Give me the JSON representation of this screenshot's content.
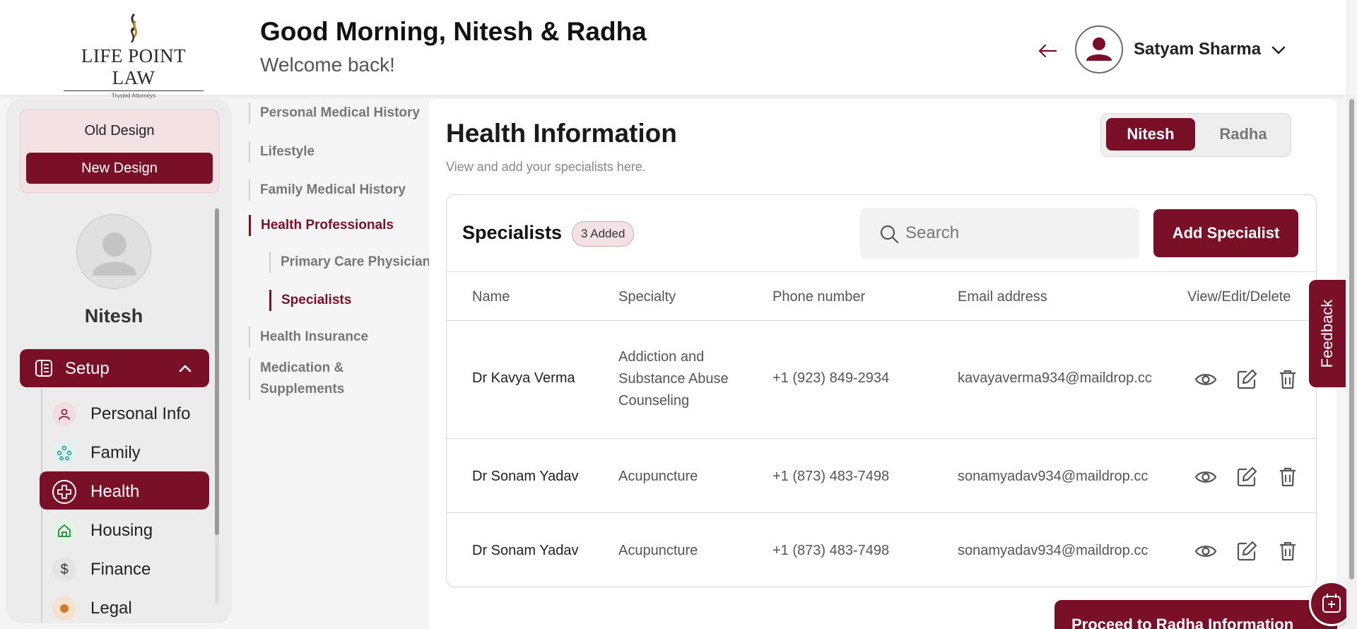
{
  "brand": {
    "name": "LIFE POINT LAW",
    "tagline": "Trusted Attorneys"
  },
  "header": {
    "greeting": "Good Morning, Nitesh & Radha",
    "subtitle": "Welcome back!",
    "user_name": "Satyam Sharma"
  },
  "sidebar": {
    "old_design_label": "Old Design",
    "new_design_label": "New Design",
    "profile_name": "Nitesh",
    "setup_label": "Setup",
    "items": [
      {
        "label": "Personal Info",
        "icon": "person-icon",
        "active": false
      },
      {
        "label": "Family",
        "icon": "family-icon",
        "active": false
      },
      {
        "label": "Health",
        "icon": "health-cross-icon",
        "active": true
      },
      {
        "label": "Housing",
        "icon": "house-icon",
        "active": false
      },
      {
        "label": "Finance",
        "icon": "dollar-icon",
        "active": false
      },
      {
        "label": "Legal",
        "icon": "legal-icon",
        "active": false
      }
    ]
  },
  "subnav": {
    "items": [
      {
        "label": "Personal Medical History",
        "active": false
      },
      {
        "label": "Lifestyle",
        "active": false
      },
      {
        "label": "Family Medical History",
        "active": false
      },
      {
        "label": "Health Professionals",
        "active": true
      },
      {
        "label": "Primary Care Physician",
        "active": false
      },
      {
        "label": "Specialists",
        "active": true
      },
      {
        "label": "Health Insurance",
        "active": false
      },
      {
        "label": "Medication &",
        "active": false
      },
      {
        "label": "Supplements",
        "active": false
      }
    ]
  },
  "main": {
    "title": "Health Information",
    "subtitle": "View and add your specialists here.",
    "toggle": {
      "selected": "Nitesh",
      "other": "Radha"
    },
    "section_title": "Specialists",
    "added_badge": "3 Added",
    "search_placeholder": "Search",
    "add_button": "Add Specialist",
    "columns": [
      "Name",
      "Specialty",
      "Phone number",
      "Email address",
      "View/Edit/Delete"
    ],
    "rows": [
      {
        "name": "Dr Kavya Verma",
        "specialty_lines": [
          "Addiction and",
          "Substance Abuse",
          "Counseling"
        ],
        "phone": "+1 (923) 849-2934",
        "email": "kavayaverma934@maildrop.cc"
      },
      {
        "name": "Dr Sonam Yadav",
        "specialty_lines": [
          "Acupuncture"
        ],
        "phone": "+1 (873) 483-7498",
        "email": "sonamyadav934@maildrop.cc"
      },
      {
        "name": "Dr Sonam Yadav",
        "specialty_lines": [
          "Acupuncture"
        ],
        "phone": "+1 (873) 483-7498",
        "email": "sonamyadav934@maildrop.cc"
      }
    ]
  },
  "feedback_label": "Feedback",
  "proceed_label": "Proceed to Radha Information",
  "colors": {
    "brand": "#7a1027",
    "brand_light": "#f4e1e4",
    "page_bg": "#f5f5f5"
  }
}
